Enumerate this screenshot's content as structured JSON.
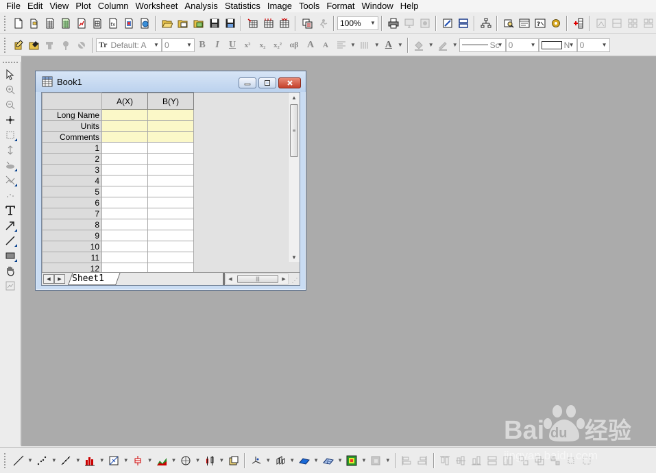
{
  "menu": [
    "File",
    "Edit",
    "View",
    "Plot",
    "Column",
    "Worksheet",
    "Analysis",
    "Statistics",
    "Image",
    "Tools",
    "Format",
    "Window",
    "Help"
  ],
  "toolbar": {
    "zoom": "100%",
    "font_name": "Default: A",
    "font_size": "0",
    "format_bold": "B",
    "format_italic": "I",
    "format_underline": "U",
    "format_superscript": "x²",
    "format_subscript": "x₂",
    "format_supersub": "x₂²",
    "format_greek": "αβ",
    "format_increase_font": "A",
    "format_decrease_font": "A",
    "line_style": "Sc",
    "line_width": "0",
    "fill_pattern": "N",
    "pattern_width": "0"
  },
  "book": {
    "title": "Book1",
    "columns": [
      "A(X)",
      "B(Y)"
    ],
    "label_rows": [
      "Long Name",
      "Units",
      "Comments"
    ],
    "rows": [
      "1",
      "2",
      "3",
      "4",
      "5",
      "6",
      "7",
      "8",
      "9",
      "10",
      "11",
      "12"
    ],
    "sheet_tab": "Sheet1"
  },
  "watermark": "Baidu经验",
  "colors": {
    "workspace": "#ababab",
    "label_cells": "#fbf8c8",
    "close_button": "#c4402a"
  }
}
